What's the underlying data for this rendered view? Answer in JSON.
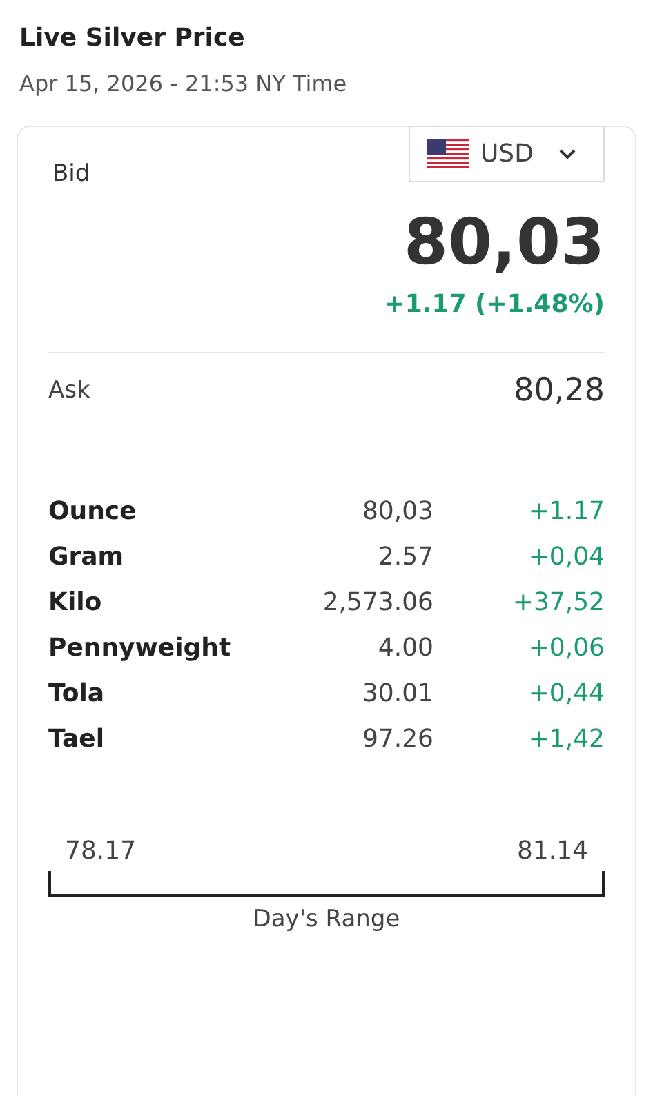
{
  "title": "Live Silver Price",
  "timestamp": "Apr 15, 2026 - 21:53 NY Time",
  "currency": {
    "label": "USD"
  },
  "bid": {
    "label": "Bid",
    "value": "80,03",
    "change": "+1.17 (+1.48%)"
  },
  "ask": {
    "label": "Ask",
    "value": "80,28"
  },
  "units": [
    {
      "name": "Ounce",
      "price": "80,03",
      "change": "+1.17"
    },
    {
      "name": "Gram",
      "price": "2.57",
      "change": "+0,04"
    },
    {
      "name": "Kilo",
      "price": "2,573.06",
      "change": "+37,52"
    },
    {
      "name": "Pennyweight",
      "price": "4.00",
      "change": "+0,06"
    },
    {
      "name": "Tola",
      "price": "30.01",
      "change": "+0,44"
    },
    {
      "name": "Tael",
      "price": "97.26",
      "change": "+1,42"
    }
  ],
  "range": {
    "low": "78.17",
    "high": "81.14",
    "label": "Day's Range"
  }
}
